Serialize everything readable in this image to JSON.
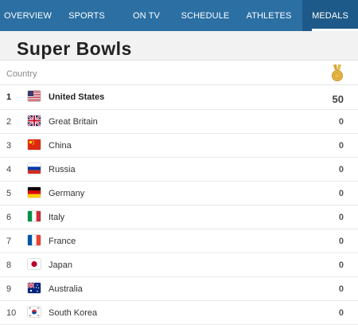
{
  "nav": {
    "items": [
      {
        "label": "OVERVIEW"
      },
      {
        "label": "SPORTS"
      },
      {
        "label": "ON TV"
      },
      {
        "label": "SCHEDULE"
      },
      {
        "label": "ATHLETES"
      },
      {
        "label": "MEDALS"
      }
    ],
    "active_index": 5,
    "colors": {
      "bar": "#2b6fa3",
      "active": "#1e5a89"
    }
  },
  "page": {
    "title": "Super Bowls"
  },
  "table": {
    "header": {
      "country": "Country",
      "medal_icon": "gold-medal-icon"
    },
    "rows": [
      {
        "rank": "1",
        "country": "United States",
        "count": "50",
        "flag": "us-flag-icon"
      },
      {
        "rank": "2",
        "country": "Great Britain",
        "count": "0",
        "flag": "gb-flag-icon"
      },
      {
        "rank": "3",
        "country": "China",
        "count": "0",
        "flag": "cn-flag-icon"
      },
      {
        "rank": "4",
        "country": "Russia",
        "count": "0",
        "flag": "ru-flag-icon"
      },
      {
        "rank": "5",
        "country": "Germany",
        "count": "0",
        "flag": "de-flag-icon"
      },
      {
        "rank": "6",
        "country": "Italy",
        "count": "0",
        "flag": "it-flag-icon"
      },
      {
        "rank": "7",
        "country": "France",
        "count": "0",
        "flag": "fr-flag-icon"
      },
      {
        "rank": "8",
        "country": "Japan",
        "count": "0",
        "flag": "jp-flag-icon"
      },
      {
        "rank": "9",
        "country": "Australia",
        "count": "0",
        "flag": "au-flag-icon"
      },
      {
        "rank": "10",
        "country": "South Korea",
        "count": "0",
        "flag": "kr-flag-icon"
      }
    ]
  }
}
